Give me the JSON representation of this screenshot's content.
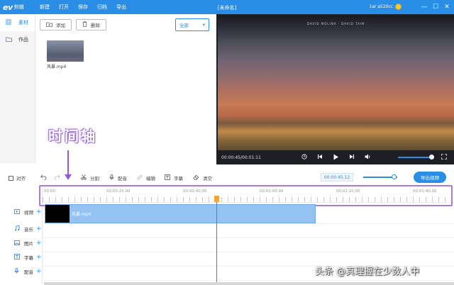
{
  "titlebar": {
    "logo_mark": "ev",
    "logo_text": "剪辑",
    "menu": [
      "新建",
      "打开",
      "保存",
      "归档",
      "导出"
    ],
    "document_title": "[未命名]",
    "user": "1ar a520cc",
    "window_buttons": [
      "—",
      "☐",
      "✕"
    ]
  },
  "sidebar": {
    "items": [
      {
        "label": "素材",
        "icon": "grid-icon",
        "active": true
      },
      {
        "label": "作品",
        "icon": "folder-icon",
        "active": false
      }
    ]
  },
  "library": {
    "add_label": "添加",
    "delete_label": "删除",
    "filter_label": "全部",
    "media": [
      {
        "name": "风暴.mp4"
      }
    ]
  },
  "preview": {
    "caption": "DAVID MOLINA  ·  DAVID TAIN",
    "timecode": "00:00:45/00:01:11",
    "volume_level": 0.9
  },
  "annotation": {
    "label": "时间轴"
  },
  "edit_toolbar": {
    "snap_label": "对齐",
    "tools": [
      {
        "label": "分割",
        "icon": "scissors-icon"
      },
      {
        "label": "配音",
        "icon": "microphone-icon"
      },
      {
        "label": "编辑",
        "icon": "pencil-icon"
      },
      {
        "label": "字幕",
        "icon": "text-icon"
      },
      {
        "label": "清空",
        "icon": "eraser-icon"
      }
    ],
    "zoom_time": "00:00:45.12",
    "export_label": "导出视频"
  },
  "timeline": {
    "ruler_labels": [
      "00:00",
      "00:00:20.00",
      "00:00:40.00",
      "00:01:00.00",
      "00:01:20.00",
      "00:01:40.00"
    ],
    "tracks": [
      {
        "label": "视频",
        "icon": "video-icon"
      },
      {
        "label": "音乐",
        "icon": "music-icon"
      },
      {
        "label": "图片",
        "icon": "image-icon"
      },
      {
        "label": "字幕",
        "icon": "text-icon"
      },
      {
        "label": "配音",
        "icon": "microphone-icon"
      }
    ],
    "clip_name": "风暴.mp4"
  },
  "watermark": "头条 @真理握在少数人中",
  "colors": {
    "accent": "#2a8ee6",
    "annotation": "#9b6ad6",
    "playhead": "#e34a3a",
    "clip": "#93c2f3"
  }
}
